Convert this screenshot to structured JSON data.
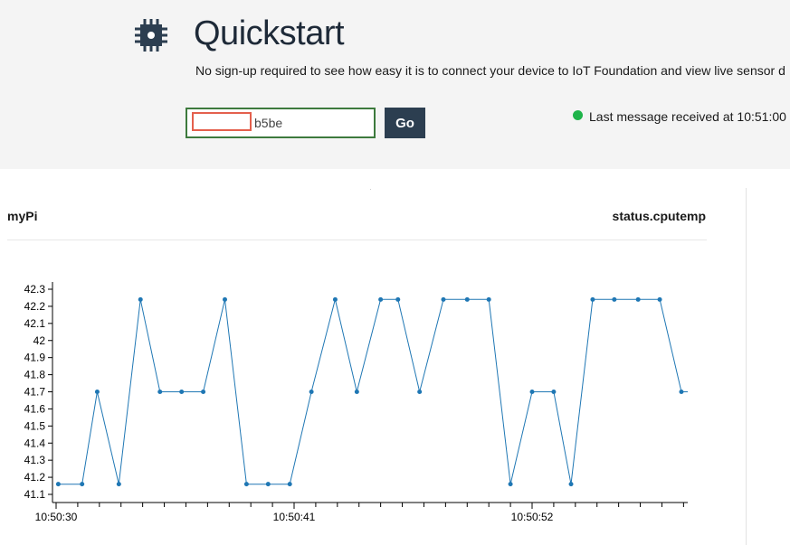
{
  "header": {
    "title": "Quickstart",
    "subtitle": "No sign-up required to see how easy it is to connect your device to IoT Foundation and view live sensor d",
    "device_id_value": "b5be",
    "go_label": "Go",
    "status_text": "Last message received at 10:51:00",
    "status_color": "#1fb44a",
    "icon": "chip-icon"
  },
  "panel": {
    "device_name": "myPi",
    "property": "status.cputemp"
  },
  "chart_data": {
    "type": "line",
    "title": "",
    "xlabel": "",
    "ylabel": "",
    "ylim": [
      41.1,
      42.3
    ],
    "yticks": [
      "41.1",
      "41.2",
      "41.3",
      "41.4",
      "41.5",
      "41.6",
      "41.7",
      "41.8",
      "41.9",
      "42",
      "42.1",
      "42.2",
      "42.3"
    ],
    "xticks": [
      "10:50:30",
      "10:50:41",
      "10:50:52"
    ],
    "xticks_seconds": [
      30,
      41,
      52
    ],
    "grid": false,
    "line_color": "#1f77b4",
    "points": [
      {
        "t": 30.1,
        "v": 41.16
      },
      {
        "t": 31.2,
        "v": 41.16
      },
      {
        "t": 31.9,
        "v": 41.7
      },
      {
        "t": 32.9,
        "v": 41.16
      },
      {
        "t": 33.9,
        "v": 42.24
      },
      {
        "t": 34.8,
        "v": 41.7
      },
      {
        "t": 35.8,
        "v": 41.7
      },
      {
        "t": 36.8,
        "v": 41.7
      },
      {
        "t": 37.8,
        "v": 42.24
      },
      {
        "t": 38.8,
        "v": 41.16
      },
      {
        "t": 39.8,
        "v": 41.16
      },
      {
        "t": 40.8,
        "v": 41.16
      },
      {
        "t": 41.8,
        "v": 41.7
      },
      {
        "t": 42.9,
        "v": 42.24
      },
      {
        "t": 43.9,
        "v": 41.7
      },
      {
        "t": 45.0,
        "v": 42.24
      },
      {
        "t": 45.8,
        "v": 42.24
      },
      {
        "t": 46.8,
        "v": 41.7
      },
      {
        "t": 47.9,
        "v": 42.24
      },
      {
        "t": 49.0,
        "v": 42.24
      },
      {
        "t": 50.0,
        "v": 42.24
      },
      {
        "t": 51.0,
        "v": 41.16
      },
      {
        "t": 52.0,
        "v": 41.7
      },
      {
        "t": 53.0,
        "v": 41.7
      },
      {
        "t": 53.8,
        "v": 41.16
      },
      {
        "t": 54.8,
        "v": 42.24
      },
      {
        "t": 55.8,
        "v": 42.24
      },
      {
        "t": 56.9,
        "v": 42.24
      },
      {
        "t": 57.9,
        "v": 42.24
      },
      {
        "t": 58.9,
        "v": 41.7
      }
    ]
  }
}
